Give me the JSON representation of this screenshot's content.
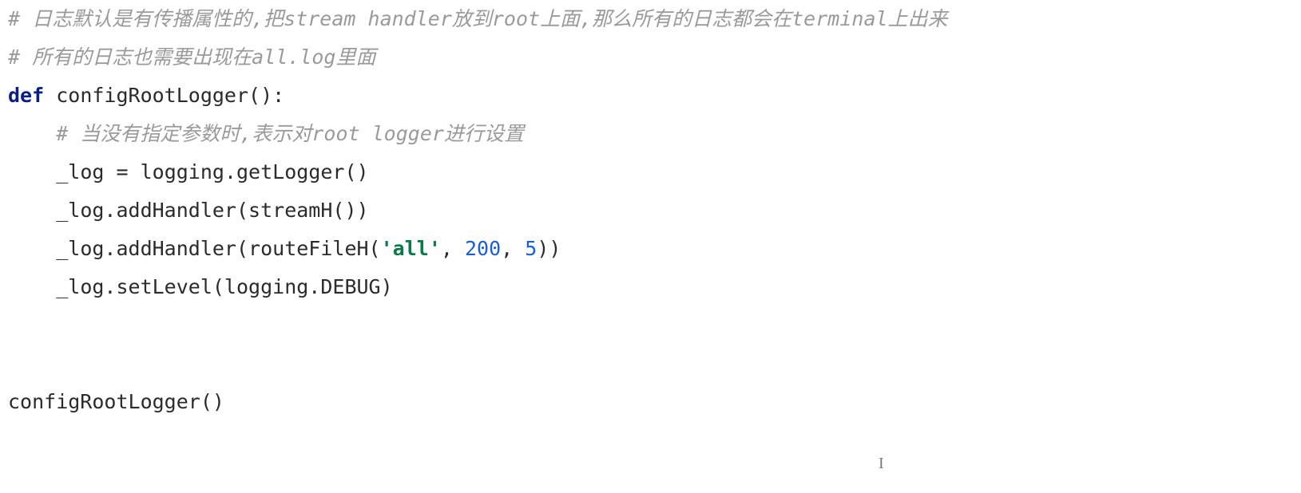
{
  "code": {
    "line1_comment": "# 日志默认是有传播属性的,把stream handler放到root上面,那么所有的日志都会在terminal上出来",
    "line2_comment": "# 所有的日志也需要出现在all.log里面",
    "def_kw": "def",
    "func_name": "configRootLogger",
    "paren_colon": "():",
    "line4_comment": "# 当没有指定参数时,表示对root logger进行设置",
    "l5_a": "_log ",
    "l5_eq": "=",
    "l5_b": " logging.getLogger()",
    "l6": "_log.addHandler(streamH())",
    "l7_a": "_log.addHandler(routeFileH(",
    "l7_str": "'all'",
    "l7_c1": ", ",
    "l7_n1": "200",
    "l7_c2": ", ",
    "l7_n2": "5",
    "l7_b": "))",
    "l8": "_log.setLevel(logging.DEBUG)",
    "l_blank": "",
    "l_call": "configRootLogger()"
  }
}
